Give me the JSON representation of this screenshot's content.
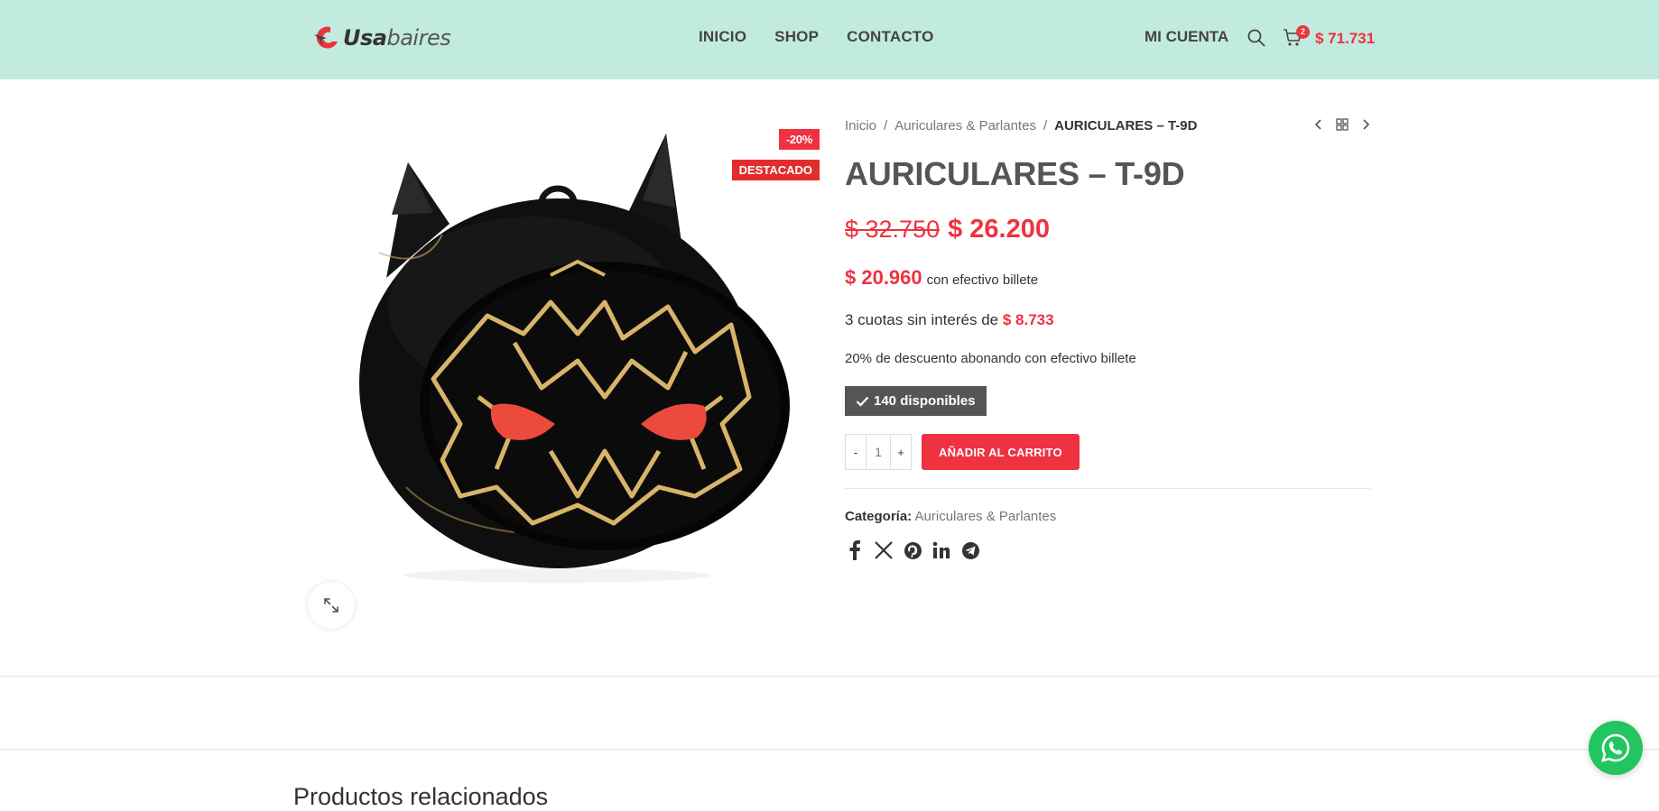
{
  "header": {
    "logo_part1": "Usa",
    "logo_part2": "baires",
    "nav": [
      "INICIO",
      "SHOP",
      "CONTACTO"
    ],
    "account_label": "MI CUENTA",
    "cart_count": "2",
    "cart_total": "$ 71.731"
  },
  "colors": {
    "header_bg": "#c2ebdf",
    "accent_red": "#ee3240",
    "stock_bg": "#555555",
    "whatsapp_green": "#22c55e"
  },
  "gallery": {
    "badge_discount": "-20%",
    "badge_featured": "DESTACADO"
  },
  "product": {
    "breadcrumb": [
      "Inicio",
      "Auriculares & Parlantes",
      "AURICULARES – T-9D"
    ],
    "title": "AURICULARES – T-9D",
    "old_price": "$ 32.750",
    "price": "$ 26.200",
    "cash_price": "$ 20.960",
    "cash_label": "con efectivo billete",
    "installments_text": "3 cuotas sin interés de",
    "installments_amount": "$ 8.733",
    "discount_note": "20% de descuento abonando con efectivo billete",
    "stock": "140 disponibles",
    "qty_minus": "-",
    "qty_value": "1",
    "qty_plus": "+",
    "add_to_cart": "AÑADIR AL CARRITO",
    "category_label": "Categoría:",
    "category_value": "Auriculares & Parlantes",
    "share_icons": [
      "facebook-icon",
      "x-icon",
      "pinterest-icon",
      "linkedin-icon",
      "telegram-icon"
    ]
  },
  "related_heading": "Productos relacionados"
}
